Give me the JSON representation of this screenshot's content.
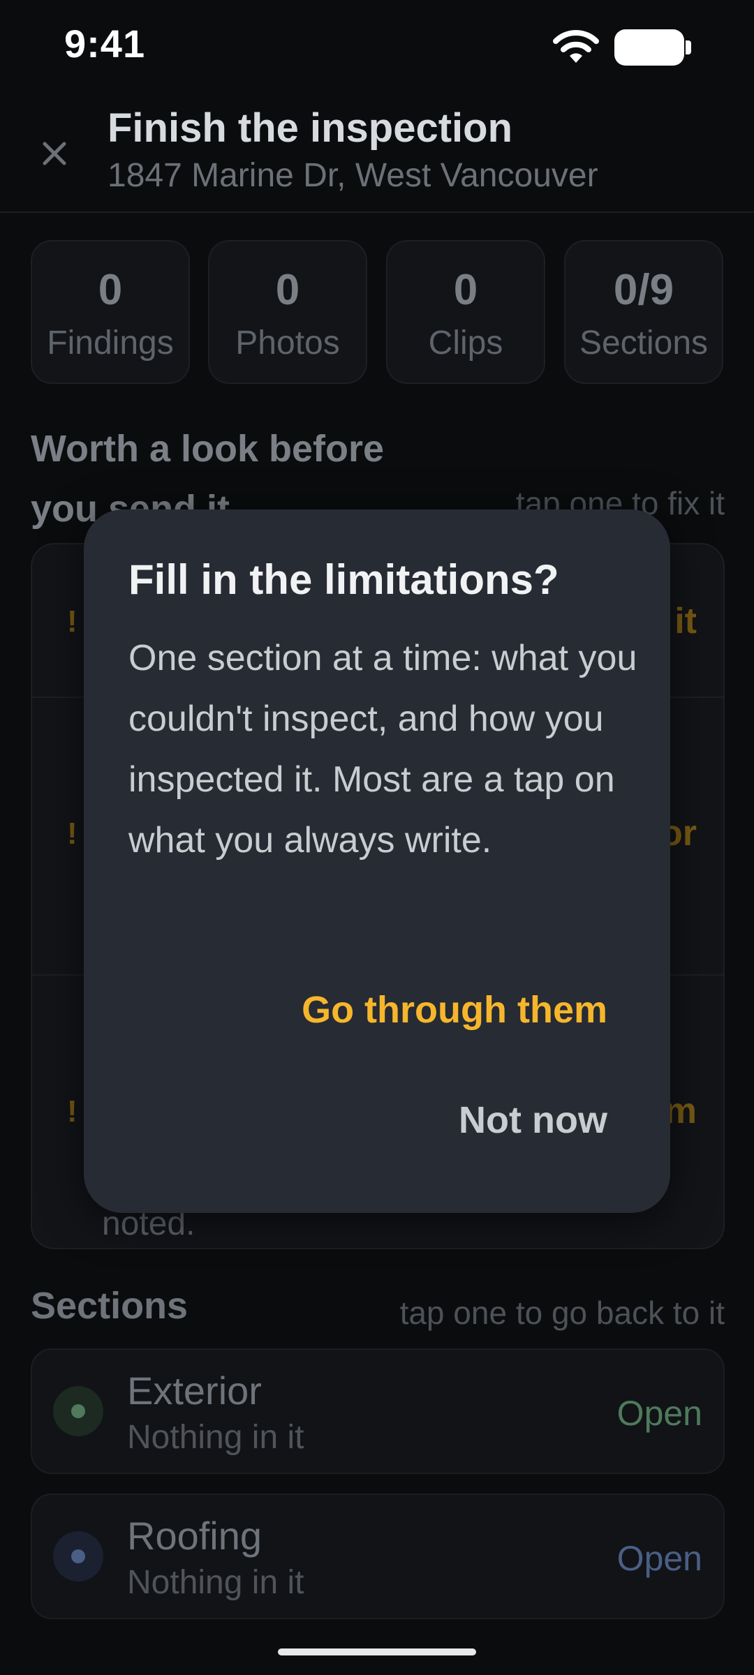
{
  "status_bar": {
    "time": "9:41",
    "wifi_icon": "wifi-icon",
    "battery_icon": "battery-icon"
  },
  "header": {
    "close_icon": "close-icon",
    "title": "Finish the inspection",
    "subtitle": "1847 Marine Dr, West Vancouver"
  },
  "stats": [
    {
      "value": "0",
      "label": "Findings"
    },
    {
      "value": "0",
      "label": "Photos"
    },
    {
      "value": "0",
      "label": "Clips"
    },
    {
      "value": "0/9",
      "label": "Sections"
    }
  ],
  "worth_a_look": {
    "title": "Worth a look before you send it",
    "hint": "tap one to fix it",
    "issue_actions": [
      "it",
      "or",
      "m"
    ],
    "issue_tail": "noted."
  },
  "sections": {
    "title": "Sections",
    "hint": "tap one to go back to it",
    "items": [
      {
        "name": "Exterior",
        "status": "Nothing in it",
        "action": "Open",
        "color": "#4f7a5c"
      },
      {
        "name": "Roofing",
        "status": "Nothing in it",
        "action": "Open",
        "color": "#4a5f86"
      }
    ]
  },
  "dialog": {
    "title": "Fill in the limitations?",
    "body": "One section at a time: what you couldn't inspect, and how you inspected it. Most are a tap on what you always write.",
    "primary_label": "Go through them",
    "secondary_label": "Not now",
    "accent": "#f6b62c"
  }
}
